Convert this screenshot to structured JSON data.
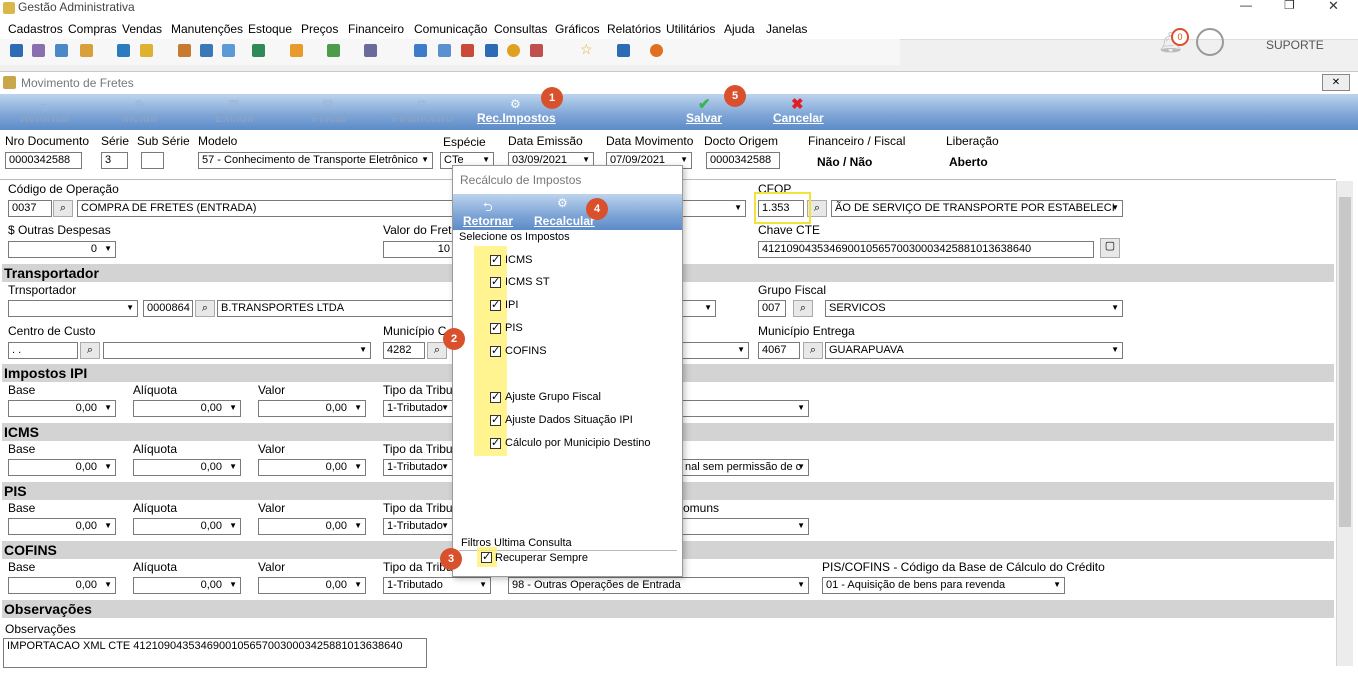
{
  "app": {
    "title": "Gestão Administrativa"
  },
  "window_controls": {
    "minimize": "—",
    "maximize": "❐",
    "close": "✕"
  },
  "menu": [
    "Cadastros",
    "Compras",
    "Vendas",
    "Manutenções",
    "Estoque",
    "Preços",
    "Financeiro",
    "Comunicação",
    "Consultas",
    "Gráficos",
    "Relatórios",
    "Utilitários",
    "Ajuda",
    "Janelas"
  ],
  "header_right": {
    "notification_count": "0",
    "user": "SUPORTE"
  },
  "form": {
    "title": "Movimento de Fretes",
    "close_glyph": "✕",
    "buttons": {
      "retornar": "Retornar",
      "incluir": "Incluir",
      "excluir": "Excluir",
      "fiscal": "Fiscal",
      "financeiro": "Financeiro",
      "rec_impostos": "Rec.Impostos",
      "salvar": "Salvar",
      "cancelar": "Cancelar"
    },
    "header": {
      "nro_documento_label": "Nro Documento",
      "nro_documento": "0000342588",
      "serie_label": "Série",
      "serie": "3",
      "sub_serie_label": "Sub Série",
      "sub_serie": "",
      "modelo_label": "Modelo",
      "modelo": "57 - Conhecimento de Transporte Eletrônico",
      "especie_label": "Espécie",
      "especie": "CTe",
      "data_emissao_label": "Data Emissão",
      "data_emissao": "03/09/2021",
      "data_movimento_label": "Data Movimento",
      "data_movimento": "07/09/2021",
      "docto_origem_label": "Docto Origem",
      "docto_origem": "0000342588",
      "financeiro_fiscal_label": "Financeiro / Fiscal",
      "financeiro_fiscal": "Não / Não",
      "liberacao_label": "Liberação",
      "liberacao": "Aberto"
    },
    "operacao": {
      "codigo_label": "Código de Operação",
      "codigo": "0037",
      "descricao": "COMPRA DE FRETES (ENTRADA)",
      "cfop_label": "CFOP",
      "cfop": "1.353",
      "cfop_desc": "ÃO DE SERVIÇO DE TRANSPORTE POR ESTABELECI",
      "outras_despesas_label": "$ Outras Despesas",
      "outras_despesas": "0",
      "valor_frete_label": "Valor do Frete",
      "valor_frete": "10",
      "chave_label": "Chave CTE",
      "chave": "41210904353469001056570030003425881013638640"
    },
    "transportador": {
      "section": "Transportador",
      "label": "Trnsportador",
      "tipo": "",
      "codigo": "0000864",
      "nome": "B.TRANSPORTES LTDA",
      "grupo_fiscal_label": "Grupo Fiscal",
      "grupo_fiscal_cod": "007",
      "grupo_fiscal": "SERVICOS",
      "centro_custo_label": "Centro de Custo",
      "centro_custo": "  .  .",
      "municipio_label": "Município C",
      "municipio_cod": "4282",
      "municipio_entrega_label": "Município Entrega",
      "municipio_entrega_cod": "4067",
      "municipio_entrega": "GUARAPUAVA"
    },
    "ipi": {
      "section": "Impostos IPI",
      "base_label": "Base",
      "aliquota_label": "Alíquota",
      "valor_label": "Valor",
      "tipo_label": "Tipo da Tribut",
      "base": "0,00",
      "aliquota": "0,00",
      "valor": "0,00",
      "tipo": "1-Tributado"
    },
    "icms": {
      "section": "ICMS",
      "base_label": "Base",
      "aliquota_label": "Alíquota",
      "valor_label": "Valor",
      "tipo_label": "Tipo da Tribut",
      "base": "0,00",
      "aliquota": "0,00",
      "valor": "0,00",
      "tipo": "1-Tributado",
      "situacao": "nal sem permissão de c"
    },
    "pis": {
      "section": "PIS",
      "base_label": "Base",
      "aliquota_label": "Alíquota",
      "valor_label": "Valor",
      "tipo_label": "Tipo da Tribut",
      "base": "0,00",
      "aliquota": "0,00",
      "valor": "0,00",
      "tipo": "1-Tributado",
      "comuns_label": "omuns"
    },
    "cofins": {
      "section": "COFINS",
      "base_label": "Base",
      "aliquota_label": "Alíquota",
      "valor_label": "Valor",
      "tipo_label": "Tipo da Tribut",
      "base": "0,00",
      "aliquota": "0,00",
      "valor": "0,00",
      "tipo": "1-Tributado",
      "operacao": "98 - Outras Operações de Entrada",
      "credito_label": "PIS/COFINS - Código da Base de Cálculo do Crédito",
      "credito": "01 - Aquisição de bens para revenda"
    },
    "observacoes": {
      "section": "Observações",
      "label": "Observações",
      "texto": "IMPORTACAO XML CTE 41210904353469001056570030003425881013638640"
    }
  },
  "dialog": {
    "title": "Recálculo de Impostos",
    "retornar": "Retornar",
    "recalcular": "Recalcular",
    "select_label": "Selecione os Impostos",
    "items": [
      "ICMS",
      "ICMS ST",
      "IPI",
      "PIS",
      "COFINS"
    ],
    "extra_items": [
      "Ajuste Grupo Fiscal",
      "Ajuste Dados Situação IPI",
      "Cálculo por Municipio Destino"
    ],
    "filtros_label": "Filtros Ultima Consulta",
    "recuperar": "Recuperar Sempre",
    "check_glyph": "✓"
  },
  "annotations": [
    "1",
    "2",
    "3",
    "4",
    "5"
  ]
}
